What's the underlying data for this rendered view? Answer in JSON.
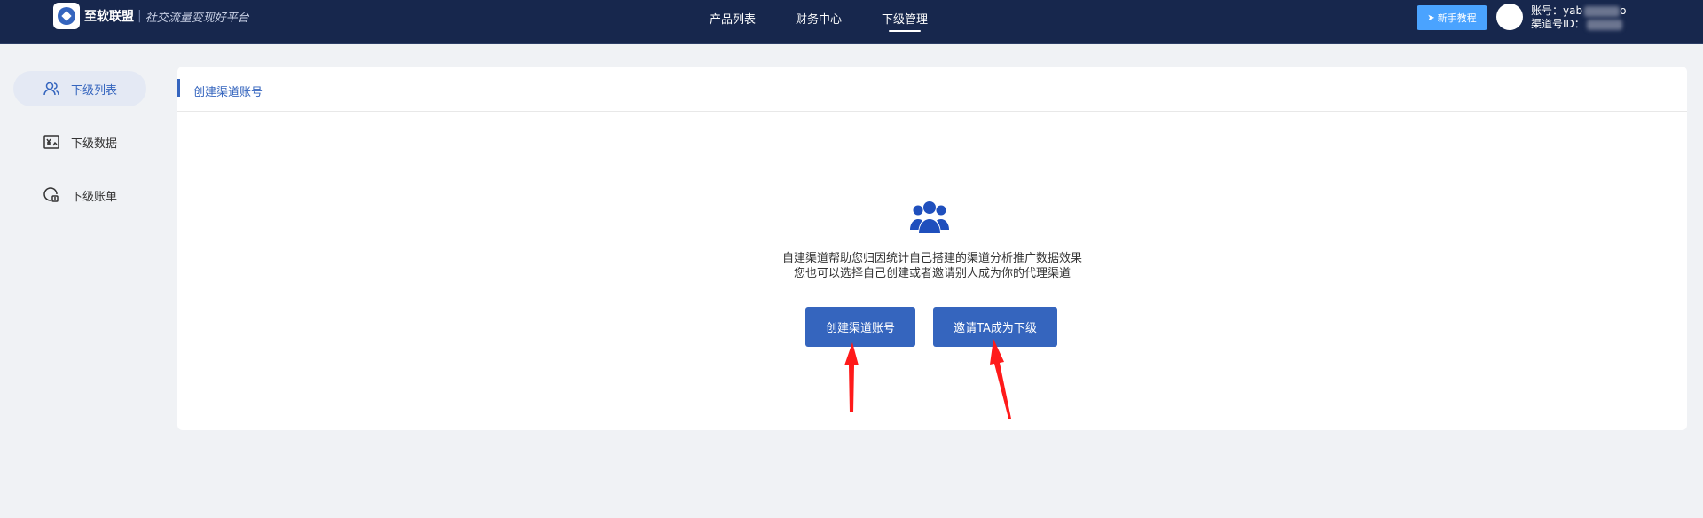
{
  "header": {
    "brand_name": "至软联盟",
    "brand_separator": "|",
    "brand_tagline": "社交流量变现好平台",
    "nav": [
      {
        "label": "产品列表"
      },
      {
        "label": "财务中心"
      },
      {
        "label": "下级管理"
      }
    ],
    "tutorial_label": "新手教程",
    "account_label": "账号：yab",
    "account_suffix": "o",
    "channel_label": "渠道号ID："
  },
  "sidebar": {
    "items": [
      {
        "label": "下级列表"
      },
      {
        "label": "下级数据"
      },
      {
        "label": "下级账单"
      }
    ]
  },
  "main": {
    "title": "创建渠道账号",
    "desc_line1": "自建渠道帮助您归因统计自己搭建的渠道分析推广数据效果",
    "desc_line2": "您也可以选择自己创建或者邀请别人成为你的代理渠道",
    "create_button": "创建渠道账号",
    "invite_button": "邀请TA成为下级"
  },
  "colors": {
    "topbar": "#17274d",
    "accent": "#3565be",
    "tutorial_button": "#4aa3ff",
    "annotation_arrow": "#ff0000"
  }
}
